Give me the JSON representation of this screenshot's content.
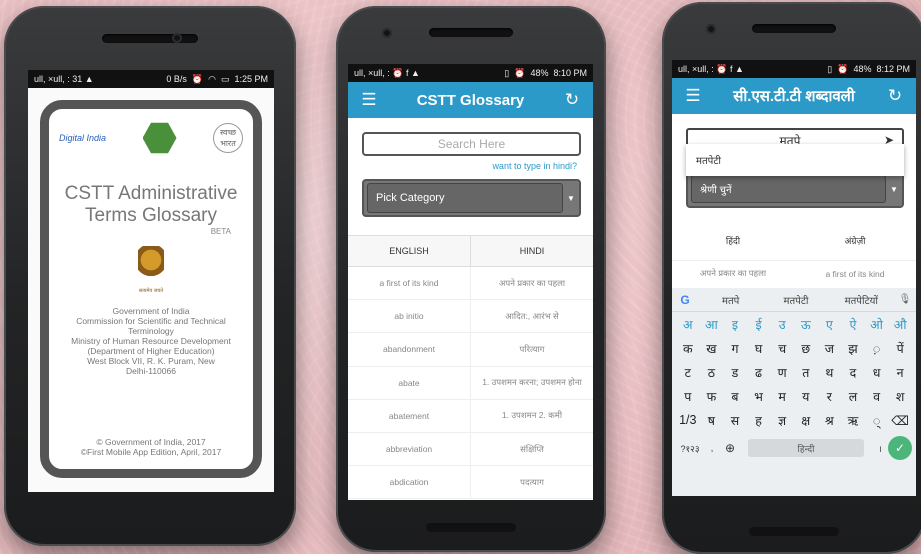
{
  "phone1": {
    "status": {
      "left": "ull, ×ull, : 31 ▲",
      "right_speed": "0 B/s",
      "time": "1:25 PM"
    },
    "logo_digital_india": "Digital India",
    "logo_swachh": "स्वच्छ भारत",
    "title_line1": "CSTT Administrative",
    "title_line2": "Terms Glossary",
    "beta": "BETA",
    "emblem_caption": "सत्यमेव जयते",
    "gov_lines": [
      "Government of India",
      "Commission for Scientific and Technical",
      "Terminology",
      "Ministry of Human Resource Development",
      "(Department of Higher Education)",
      "West Block VII, R. K. Puram, New",
      "Delhi-110066"
    ],
    "footer_line1": "© Government of India, 2017",
    "footer_line2": "©First Mobile App Edition, April, 2017"
  },
  "phone2": {
    "status": {
      "left": "ull, ×ull, : ⏰ f ▲",
      "battery": "48%",
      "time": "8:10 PM"
    },
    "title": "CSTT Glossary",
    "search_placeholder": "Search Here",
    "hint": "want to type in hindi?",
    "pick_category": "Pick Category",
    "col_english": "ENGLISH",
    "col_hindi": "HINDI",
    "rows": [
      {
        "en": "a first of its kind",
        "hi": "अपने प्रकार का पहला"
      },
      {
        "en": "ab initio",
        "hi": "आदित:, आरंभ से"
      },
      {
        "en": "abandonment",
        "hi": "परित्याग"
      },
      {
        "en": "abate",
        "hi": "1. उपशमन करना; उपशमन होना"
      },
      {
        "en": "abatement",
        "hi": "1. उपशमन 2. कमी"
      },
      {
        "en": "abbreviation",
        "hi": "संक्षिप्ति"
      },
      {
        "en": "abdication",
        "hi": "पदत्याग"
      }
    ]
  },
  "phone3": {
    "status": {
      "left": "ull, ×ull, : ⏰ f ▲",
      "battery": "48%",
      "time": "8:12 PM"
    },
    "title": "सी.एस.टी.टी शब्दावली",
    "search_value": "मतपे",
    "suggestion": "मतपेटी",
    "pick_category": "श्रेणी चुनें",
    "col_hindi": "हिंदी",
    "col_english": "अंग्रेज़ी",
    "row_hi": "अपने प्रकार का पहला",
    "row_en": "a first of its kind",
    "kb_suggestions": [
      "मतपे",
      "मतपेटी",
      "मतपेटियों"
    ],
    "kb_rows": [
      [
        "अ",
        "आ",
        "इ",
        "ई",
        "उ",
        "ऊ",
        "ए",
        "ऐ",
        "ओ",
        "औ"
      ],
      [
        "क",
        "ख",
        "ग",
        "घ",
        "च",
        "छ",
        "ज",
        "झ",
        "़",
        "पें"
      ],
      [
        "ट",
        "ठ",
        "ड",
        "ढ",
        "ण",
        "त",
        "थ",
        "द",
        "ध",
        "न"
      ],
      [
        "प",
        "फ",
        "ब",
        "भ",
        "म",
        "य",
        "र",
        "ल",
        "व",
        "श"
      ],
      [
        "1/3",
        "ष",
        "स",
        "ह",
        "ज्ञ",
        "क्ष",
        "श्र",
        "ऋ",
        "्",
        "⌫"
      ]
    ],
    "kb_num": "?१२३",
    "kb_space": "हिन्दी",
    "kb_period": "।"
  },
  "colors": {
    "appbar": "#2b9ac8",
    "bezel": "#232425",
    "background": "#ecc3c6",
    "enter": "#4cb67a"
  }
}
